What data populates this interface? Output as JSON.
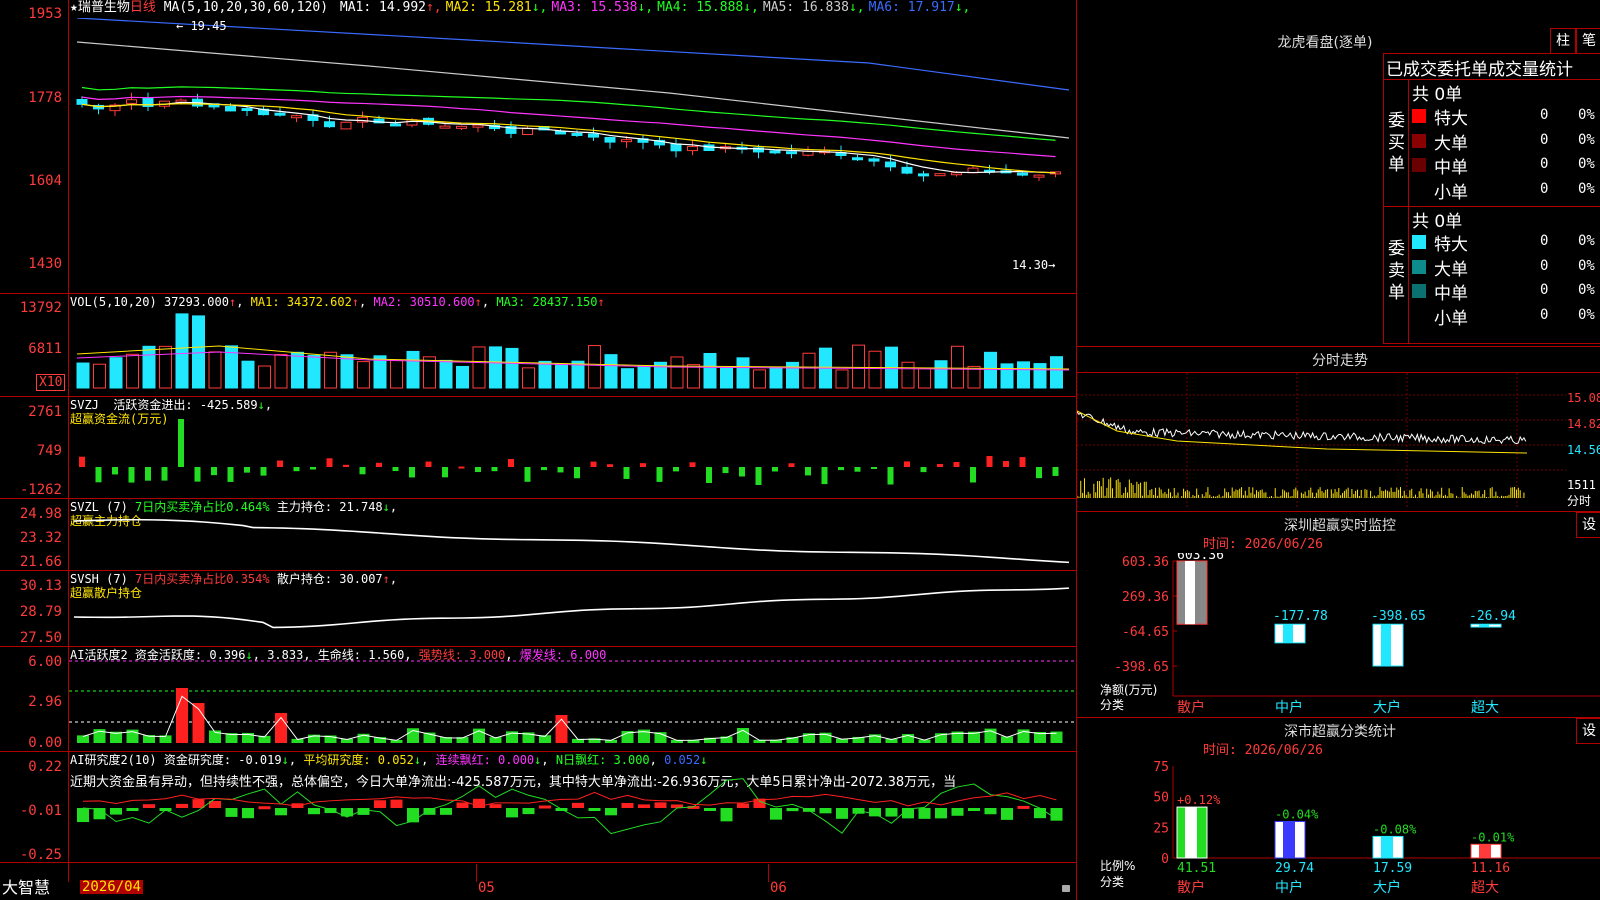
{
  "stock": {
    "name": "瑞普生物",
    "period": "日线",
    "star": "★"
  },
  "price_header": {
    "ma_label": "MA(5,10,20,30,60,120)",
    "ma": [
      {
        "label": "MA1: 14.992",
        "arrow": "↑",
        "color": "#ffffff"
      },
      {
        "label": "MA2: 15.281",
        "arrow": "↓",
        "color": "#ffe400"
      },
      {
        "label": "MA3: 15.538",
        "arrow": "↓",
        "color": "#ff35ff"
      },
      {
        "label": "MA4: 15.888",
        "arrow": "↓",
        "color": "#22ff22"
      },
      {
        "label": "MA5: 16.838",
        "arrow": "↓",
        "color": "#cccccc"
      },
      {
        "label": "MA6: 17.917",
        "arrow": "↓",
        "color": "#3a6bff"
      }
    ],
    "high_mark": "19.45",
    "low_mark": "14.30"
  },
  "price_axis": [
    "1953",
    "1778",
    "1604",
    "1430"
  ],
  "vol_header": {
    "label": "VOL(5,10,20)",
    "value": "37293.000",
    "ma1": "MA1: 34372.602",
    "ma2": "MA2: 30510.600",
    "ma3": "MA3: 28437.150"
  },
  "vol_axis": [
    "13792",
    "6811"
  ],
  "vol_unit": "X10",
  "svzj": {
    "label": "SVZJ",
    "title": "活跃资金进出:",
    "value": "-425.589",
    "subtitle": "超赢资金流(万元)",
    "axis": [
      "2761",
      "749",
      "-1262"
    ]
  },
  "svzl": {
    "label": "SVZL (7)",
    "pct": "7日内买卖净占比0.464%",
    "hold": "主力持仓: 21.748",
    "subtitle": "超赢主力持仓",
    "axis": [
      "24.98",
      "23.32",
      "21.66"
    ]
  },
  "svsh": {
    "label": "SVSH (7)",
    "pct": "7日内买卖净占比0.354%",
    "hold": "散户持仓: 30.007",
    "subtitle": "超赢散户持仓",
    "axis": [
      "30.13",
      "28.79",
      "27.50"
    ]
  },
  "ai1": {
    "label": "AI活跃度2",
    "t1": "资金活跃度: 0.396",
    "t2": "3.833",
    "t3": "生命线: 1.560",
    "t4": "强势线: 3.000",
    "t5": "爆发线: 6.000",
    "axis": [
      "6.00",
      "2.96",
      "0.00"
    ]
  },
  "ai2": {
    "label": "AI研究度2(10)",
    "t1": "资金研究度: -0.019",
    "t2": "平均研究度: 0.052",
    "t3": "连续飘红: 0.000",
    "t4": "N日飘红: 3.000",
    "t5": "0.052",
    "axis": [
      "0.22",
      "-0.01",
      "-0.25"
    ],
    "comment": "近期大资金虽有异动，但持续性不强，总体偏空，今日大单净流出:-425.587万元，其中特大单净流出:-26.936万元，大单5日累计净出-2072.38万元，当"
  },
  "date_axis": {
    "first": "2026/04",
    "m2": "05",
    "m3": "06"
  },
  "logo": "大智慧",
  "longhu": {
    "title": "龙虎看盘(逐单)",
    "btn1": "柱",
    "btn2": "笔",
    "header": "已成交委托单成交量统计",
    "buy": {
      "label": "委买单",
      "total": "共 0单",
      "rows": [
        {
          "name": "特大",
          "val": "0",
          "pct": "0%",
          "color": "#ff0000"
        },
        {
          "name": "大单",
          "val": "0",
          "pct": "0%",
          "color": "#8b0000"
        },
        {
          "name": "中单",
          "val": "0",
          "pct": "0%",
          "color": "#6b0000"
        },
        {
          "name": "小单",
          "val": "0",
          "pct": "0%",
          "color": "#000000"
        }
      ]
    },
    "sell": {
      "label": "委卖单",
      "total": "共 0单",
      "rows": [
        {
          "name": "特大",
          "val": "0",
          "pct": "0%",
          "color": "#22e8ff"
        },
        {
          "name": "大单",
          "val": "0",
          "pct": "0%",
          "color": "#0e8c8c"
        },
        {
          "name": "中单",
          "val": "0",
          "pct": "0%",
          "color": "#0b7070"
        },
        {
          "name": "小单",
          "val": "0",
          "pct": "0%",
          "color": "#000000"
        }
      ]
    }
  },
  "fenshi": {
    "title": "分时走势",
    "axis": [
      "15.08",
      "14.82",
      "14.56"
    ],
    "vol_axis": "1511",
    "bottom": "分时"
  },
  "monitor": {
    "title": "深圳超赢实时监控",
    "btn": "设",
    "time": "时间: 2026/06/26",
    "axis": [
      "603.36",
      "269.36",
      "-64.65",
      "-398.65"
    ],
    "ylabel": "净额(万元)",
    "xlabel": "分类",
    "cats": [
      "散户",
      "中户",
      "大户",
      "超大"
    ],
    "values_text": [
      "603.36",
      "-177.78",
      "-398.65",
      "-26.94"
    ]
  },
  "classstat": {
    "title": "深市超赢分类统计",
    "btn": "设",
    "time": "时间: 2026/06/26",
    "axis": [
      "75",
      "50",
      "25",
      "0"
    ],
    "ylabel": "比例%",
    "xlabel": "分类",
    "cats": [
      "散户",
      "中户",
      "大户",
      "超大"
    ],
    "top_text": [
      "+0.12%",
      "-0.04%",
      "-0.08%",
      "-0.01%"
    ],
    "bottom_text": [
      "41.51",
      "29.74",
      "17.59",
      "11.16"
    ]
  },
  "chart_data": [
    {
      "type": "bar",
      "title": "深圳超赢实时监控",
      "ylabel": "净额(万元)",
      "xlabel": "分类",
      "categories": [
        "散户",
        "中户",
        "大户",
        "超大"
      ],
      "values": [
        603.36,
        -177.78,
        -398.65,
        -26.94
      ],
      "ylim": [
        -398.65,
        603.36
      ]
    },
    {
      "type": "bar",
      "title": "深市超赢分类统计",
      "ylabel": "比例%",
      "xlabel": "分类",
      "categories": [
        "散户",
        "中户",
        "大户",
        "超大"
      ],
      "values": [
        41.51,
        29.74,
        17.59,
        11.16
      ],
      "ylim": [
        0,
        75
      ]
    }
  ],
  "colors": {
    "up": "#ff3b3b",
    "down": "#22e8ff",
    "frame": "#b00000",
    "bg": "#000000"
  }
}
